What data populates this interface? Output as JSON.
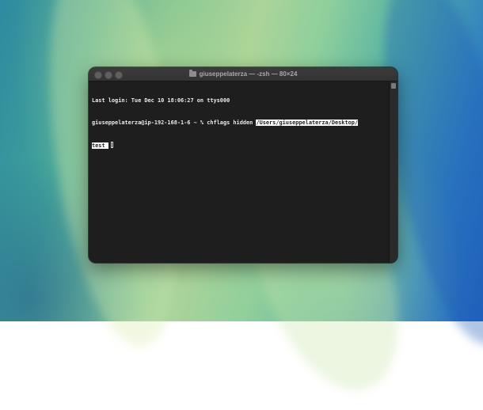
{
  "window": {
    "title": "giuseppelaterza — -zsh — 80×24",
    "title_icon": "folder-icon",
    "traffic_lights": [
      "close",
      "minimize",
      "zoom"
    ]
  },
  "terminal": {
    "last_login": "Last login: Tue Dec 10 18:06:27 on ttys000",
    "prompt": "giuseppelaterza@ip-192-168-1-6 ~ % ",
    "command": "chflags hidden ",
    "selected_path": "/Users/giuseppelaterza/Desktop/",
    "selected_continuation": "test "
  },
  "colors": {
    "terminal_background": "#1e1e1e",
    "terminal_text": "#eaeaea",
    "selection": "#ffffff"
  }
}
